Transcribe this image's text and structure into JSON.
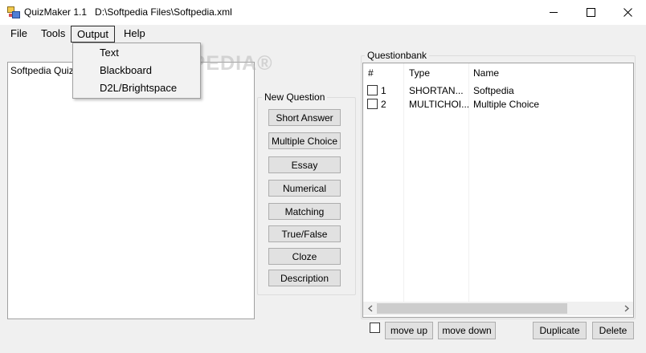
{
  "window": {
    "title": "QuizMaker 1.1   D:\\Softpedia Files\\Softpedia.xml",
    "controls": {
      "minimize": "minimize-icon",
      "maximize": "maximize-icon",
      "close": "close-icon"
    }
  },
  "menu": {
    "items": [
      {
        "label": "File"
      },
      {
        "label": "Tools"
      },
      {
        "label": "Output"
      },
      {
        "label": "Help"
      }
    ],
    "dropdown": [
      {
        "label": "Text"
      },
      {
        "label": "Blackboard"
      },
      {
        "label": "D2L/Brightspace"
      }
    ]
  },
  "watermark": "SOFTPEDIA®",
  "quiz_tree": {
    "root": "Softpedia Quiz"
  },
  "new_question": {
    "legend": "New Question",
    "buttons": [
      "Short Answer",
      "Multiple Choice",
      "Essay",
      "Numerical",
      "Matching",
      "True/False",
      "Cloze",
      "Description"
    ]
  },
  "questionbank": {
    "legend": "Questionbank",
    "columns": [
      "#",
      "Type",
      "Name"
    ],
    "rows": [
      {
        "num": "1",
        "type": "SHORTAN...",
        "name": "Softpedia"
      },
      {
        "num": "2",
        "type": "MULTICHOI...",
        "name": "Multiple Choice"
      }
    ]
  },
  "bottom": {
    "move_up": "move up",
    "move_down": "move down",
    "duplicate": "Duplicate",
    "delete": "Delete"
  },
  "colors": {
    "window_bg": "#f0f0f0",
    "titlebar_bg": "#ffffff",
    "button_bg": "#e1e1e1",
    "button_border": "#adadad"
  }
}
